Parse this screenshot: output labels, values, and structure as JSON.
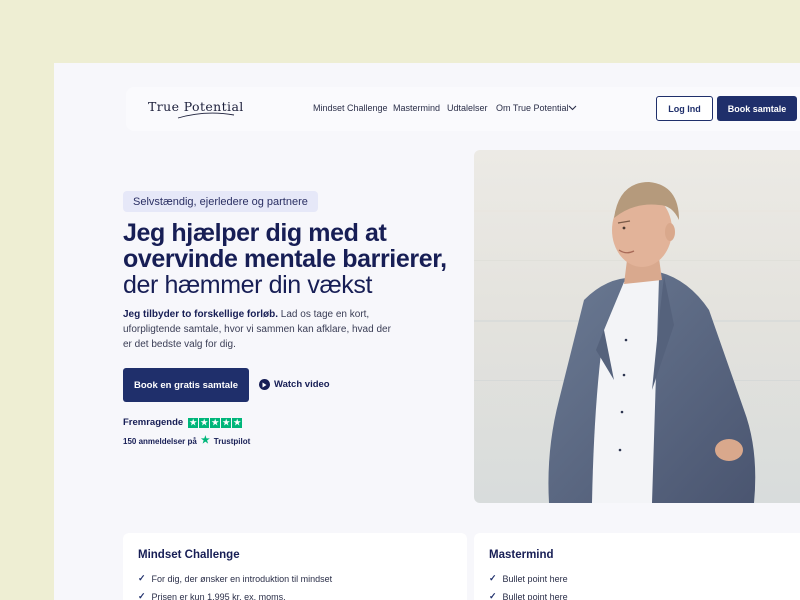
{
  "header": {
    "logo_text": "True Potential",
    "nav": [
      "Mindset Challenge",
      "Mastermind",
      "Udtalelser",
      "Om True Potential"
    ],
    "login_label": "Log Ind",
    "book_label": "Book samtale"
  },
  "hero": {
    "badge": "Selvstændig, ejerledere og partnere",
    "headline_bold": "Jeg hjælper dig med at overvinde mentale barrierer,",
    "headline_regular": "der hæmmer din vækst",
    "intro_bold": "Jeg tilbyder to forskellige forløb.",
    "intro_rest": " Lad os tage en kort, uforpligtende samtale, hvor vi sammen kan afklare, hvad der er det bedste valg for dig.",
    "cta_label": "Book en gratis samtale",
    "watch_label": "Watch video",
    "rating_label": "Fremragende",
    "stars": 5,
    "reviews_text": "150 anmeldelser på",
    "trustpilot": "Trustpilot"
  },
  "cards": [
    {
      "title": "Mindset Challenge",
      "items": [
        "For dig, der ønsker en introduktion til mindset",
        "Prisen er kun 1.995 kr. ex. moms."
      ]
    },
    {
      "title": "Mastermind",
      "items": [
        "Bullet point here",
        "Bullet point here"
      ]
    }
  ],
  "colors": {
    "background": "#eeeed3",
    "brand_navy": "#1f2f6b",
    "trustpilot_green": "#00b67a"
  },
  "icons": [
    "chevron-down-icon",
    "play-icon",
    "star-icon",
    "check-icon"
  ]
}
